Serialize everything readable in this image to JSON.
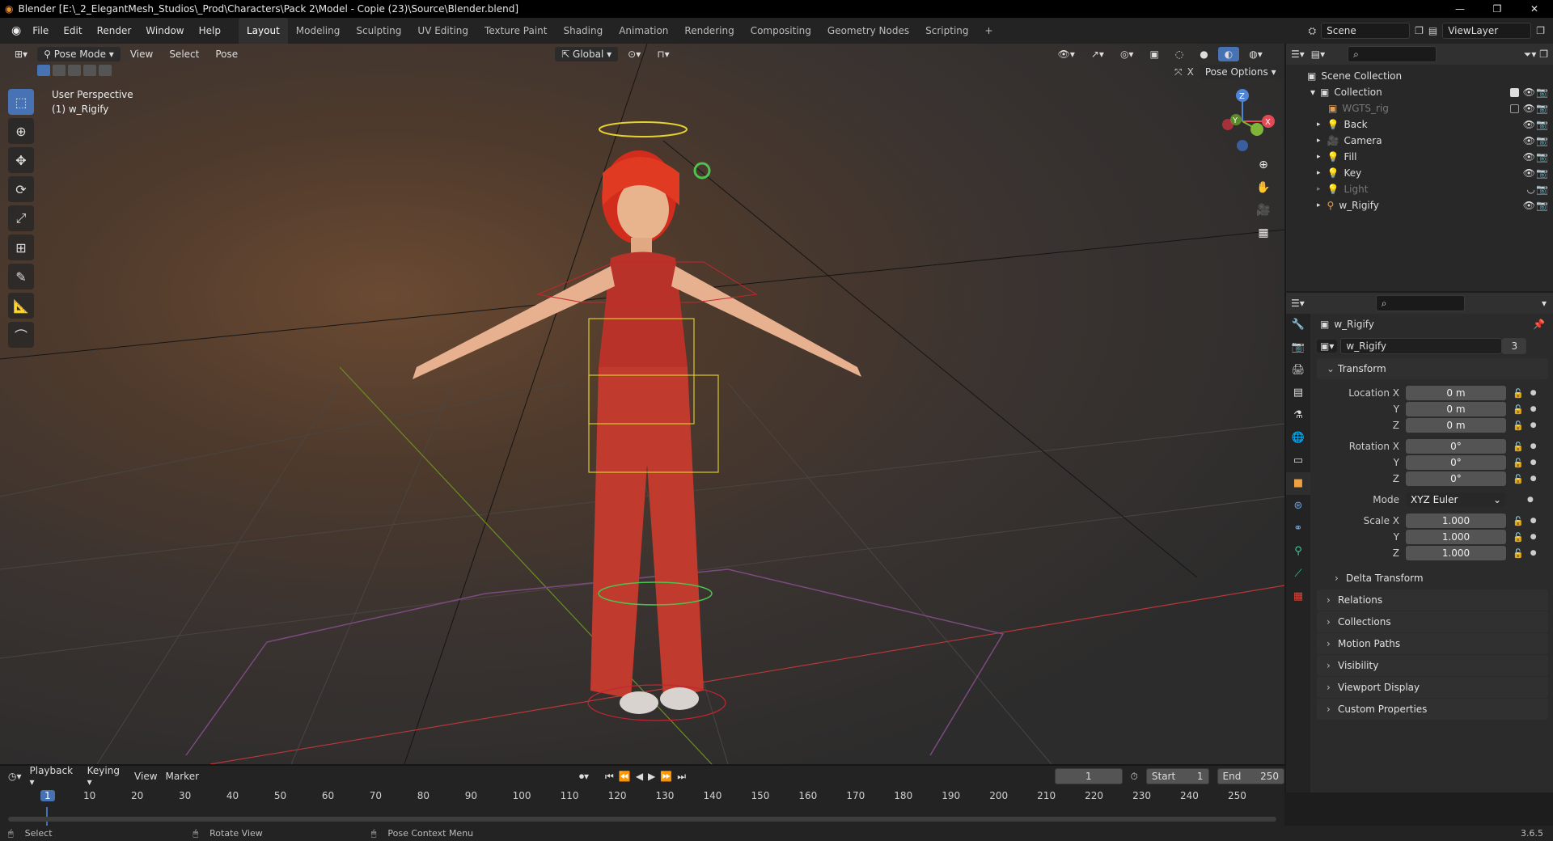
{
  "window": {
    "title": "Blender [E:\\_2_ElegantMesh_Studios\\_Prod\\Characters\\Pack 2\\Model - Copie (23)\\Source\\Blender.blend]",
    "minimize": "—",
    "maximize": "❐",
    "close": "✕"
  },
  "menu": [
    "File",
    "Edit",
    "Render",
    "Window",
    "Help"
  ],
  "workspaces": [
    {
      "label": "Layout",
      "active": true
    },
    {
      "label": "Modeling"
    },
    {
      "label": "Sculpting"
    },
    {
      "label": "UV Editing"
    },
    {
      "label": "Texture Paint"
    },
    {
      "label": "Shading"
    },
    {
      "label": "Animation"
    },
    {
      "label": "Rendering"
    },
    {
      "label": "Compositing"
    },
    {
      "label": "Geometry Nodes"
    },
    {
      "label": "Scripting"
    }
  ],
  "add_workspace": "+",
  "scene": {
    "label": "Scene"
  },
  "viewlayer": {
    "label": "ViewLayer"
  },
  "viewport": {
    "mode": "Pose Mode",
    "menus": [
      "View",
      "Select",
      "Pose"
    ],
    "orientation": "Global",
    "pose_options": "Pose Options",
    "overlay_line1": "User Perspective",
    "overlay_line2": "(1) w_Rigify",
    "gizmo": {
      "z": "Z",
      "y": "Y",
      "x": "X"
    }
  },
  "outliner": {
    "root": "Scene Collection",
    "collection": "Collection",
    "items": [
      {
        "name": "WGTS_rig",
        "dim": true,
        "check": "off"
      },
      {
        "name": "Back"
      },
      {
        "name": "Camera"
      },
      {
        "name": "Fill"
      },
      {
        "name": "Key"
      },
      {
        "name": "Light",
        "dim": true
      },
      {
        "name": "w_Rigify"
      }
    ]
  },
  "properties": {
    "object_name": "w_Rigify",
    "data_name": "w_Rigify",
    "data_users": "3",
    "transform_title": "Transform",
    "location": {
      "label": "Location X",
      "x": "0 m",
      "y": "0 m",
      "z": "0 m"
    },
    "rotation": {
      "label": "Rotation X",
      "x": "0°",
      "y": "0°",
      "z": "0°"
    },
    "mode": {
      "label": "Mode",
      "value": "XYZ Euler"
    },
    "scale": {
      "label": "Scale X",
      "x": "1.000",
      "y": "1.000",
      "z": "1.000"
    },
    "axis_y": "Y",
    "axis_z": "Z",
    "delta": "Delta Transform",
    "panels": [
      "Relations",
      "Collections",
      "Motion Paths",
      "Visibility",
      "Viewport Display",
      "Custom Properties"
    ]
  },
  "timeline": {
    "menus": [
      "Playback",
      "Keying",
      "View",
      "Marker"
    ],
    "current_frame": "1",
    "start_label": "Start",
    "start": "1",
    "end_label": "End",
    "end": "250",
    "ticks": [
      "1",
      "10",
      "20",
      "30",
      "40",
      "50",
      "60",
      "70",
      "80",
      "90",
      "100",
      "110",
      "120",
      "130",
      "140",
      "150",
      "160",
      "170",
      "180",
      "190",
      "200",
      "210",
      "220",
      "230",
      "240",
      "250"
    ]
  },
  "status": {
    "select": "Select",
    "rotate": "Rotate View",
    "context": "Pose Context Menu",
    "version": "3.6.5"
  },
  "colors": {
    "accent": "#4772b3",
    "header": "#303030",
    "bg": "#1d1d1d"
  }
}
